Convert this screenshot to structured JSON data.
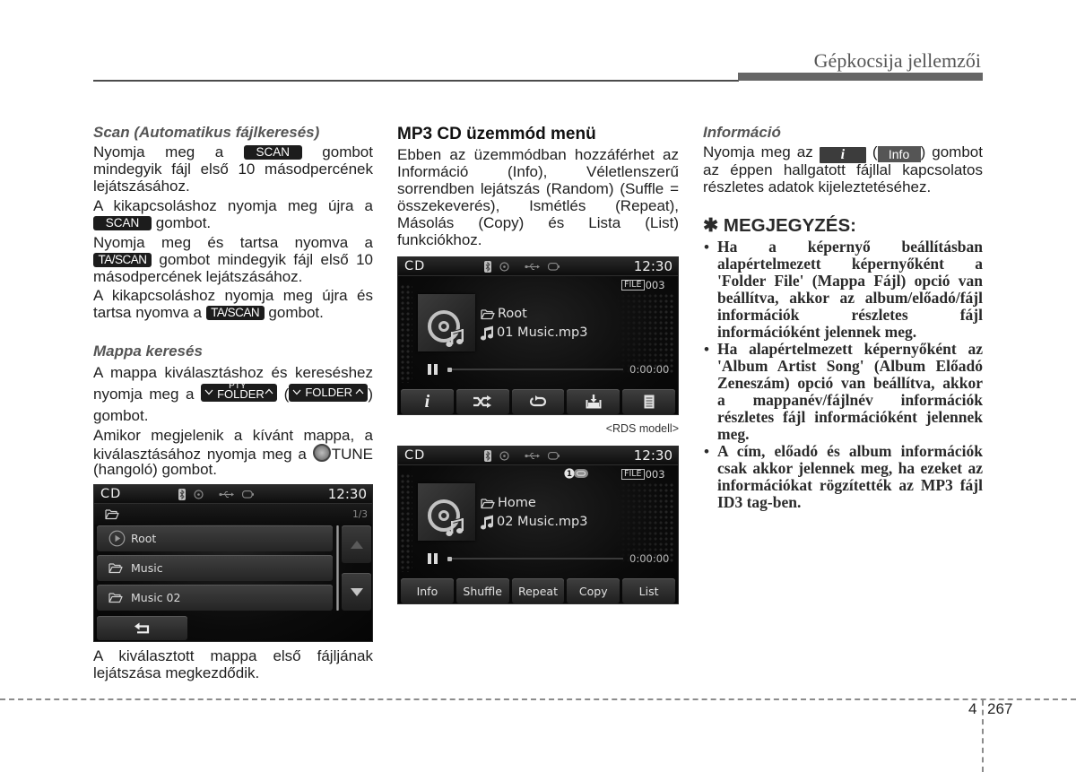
{
  "header": {
    "title": "Gépkocsija jellemzői"
  },
  "scan": {
    "heading": "Scan (Automatikus fájlkeresés)",
    "p1": {
      "l1a": "Nyomja meg a",
      "button": "SCAN",
      "l1b": "gombot",
      "l2": "mindegyik fájl első 10 másodpercének",
      "l3": "lejátszásához."
    },
    "p2": {
      "l1": "A kikapcsoláshoz nyomja meg újra a",
      "button": "SCAN",
      "l2b": "gombot."
    },
    "p3": {
      "l1": "Nyomja meg és tartsa nyomva a",
      "button": "TA/SCAN",
      "l2b": "gombot mindegyik fájl első 10",
      "l3": "másodpercének lejátszásához."
    },
    "p4": {
      "l1": "A kikapcsoláshoz nyomja meg újra és",
      "l2a": "tartsa nyomva a",
      "button": "TA/SCAN",
      "l2b": "gombot."
    }
  },
  "folder_search": {
    "heading": "Mappa keresés",
    "p1": {
      "l1": "A mappa kiválasztáshoz és kereséshez",
      "l2a": "nyomja meg a",
      "button1_top": "PTY",
      "button1": "FOLDER",
      "paren_open": "(",
      "button2": "FOLDER",
      "paren_close": ")",
      "l3": "gombot."
    },
    "p2": {
      "l1": "Amikor megjelenik a kívánt mappa, a",
      "l2a": "kiválasztásához nyomja meg a",
      "knob_label": "TUNE",
      "l3": "(hangoló) gombot."
    }
  },
  "folder_screen": {
    "mode": "CD",
    "time": "12:30",
    "page": "1/3",
    "status_icons": [
      "bluetooth-icon",
      "disc-icon",
      "usb-icon",
      "device-icon"
    ],
    "items": [
      {
        "label": "Root",
        "icon": "play-circle-icon"
      },
      {
        "label": "Music",
        "icon": "folder-icon"
      },
      {
        "label": "Music 02",
        "icon": "folder-icon"
      }
    ],
    "controls": [
      "scroll-up-icon",
      "scroll-down-icon",
      "back-arrow-icon"
    ]
  },
  "folder_result": {
    "l1": "A kiválasztott mappa első fájljának",
    "l2": "lejátszása megkezdődik."
  },
  "mp3_menu": {
    "heading": "MP3 CD üzemmód menü",
    "lines": [
      "Ebben az üzemmódban hozzáférhet az",
      "Információ (Info), Véletlenszerű",
      "sorrendben lejátszás (Random) (Suffle =",
      "összekeverés), Ismétlés (Repeat),",
      "Másolás (Copy) és Lista (List)",
      "funkciókhoz."
    ]
  },
  "screen_rds": {
    "mode": "CD",
    "time": "12:30",
    "file_label": "FILE",
    "file_number": "003",
    "folder": "Root",
    "track": "01 Music.mp3",
    "elapsed": "0:00:00",
    "progress": 0,
    "info_glyph": "i",
    "buttons": [
      "info-icon",
      "shuffle-icon",
      "repeat-icon",
      "copy-icon",
      "list-icon"
    ]
  },
  "caption": "<RDS modell>",
  "screen_std": {
    "mode": "CD",
    "time": "12:30",
    "repeat_badge": "1",
    "file_label": "FILE",
    "file_number": "003",
    "folder": "Home",
    "track": "02 Music.mp3",
    "elapsed": "0:00:00",
    "progress": 0,
    "buttons": [
      "Info",
      "Shuffle",
      "Repeat",
      "Copy",
      "List"
    ]
  },
  "info": {
    "heading": "Információ",
    "l1a": "Nyomja meg az",
    "button_i": "i",
    "paren_open": "(",
    "button_info": "Info",
    "l1b": ") gombot",
    "l2": "az éppen hallgatott fájllal kapcsolatos",
    "l3": "részletes adatok kijeleztetéséhez."
  },
  "note": {
    "heading": "✱ MEGJEGYZÉS:",
    "bullet": "•",
    "bullets": [
      {
        "lines": [
          "Ha a képernyő beállításban",
          "alapértelmezett képernyőként a",
          "'Folder File' (Mappa Fájl) opció van",
          "beállítva, akkor az album/előadó/fájl",
          "információk részletes fájl",
          "információként jelennek meg."
        ]
      },
      {
        "lines": [
          "Ha alapértelmezett képernyőként az",
          "'Album Artist Song' (Album Előadó",
          "Zeneszám) opció van beállítva, akkor",
          "a mappanév/fájlnév információk",
          "részletes fájl információként jelennek",
          "meg."
        ]
      },
      {
        "lines": [
          "A cím, előadó és album információk",
          "csak akkor jelennek meg, ha ezeket az",
          "információkat rögzítették az MP3 fájl",
          "ID3 tag-ben."
        ]
      }
    ]
  },
  "footer": {
    "chapter": "4",
    "page": "267"
  }
}
